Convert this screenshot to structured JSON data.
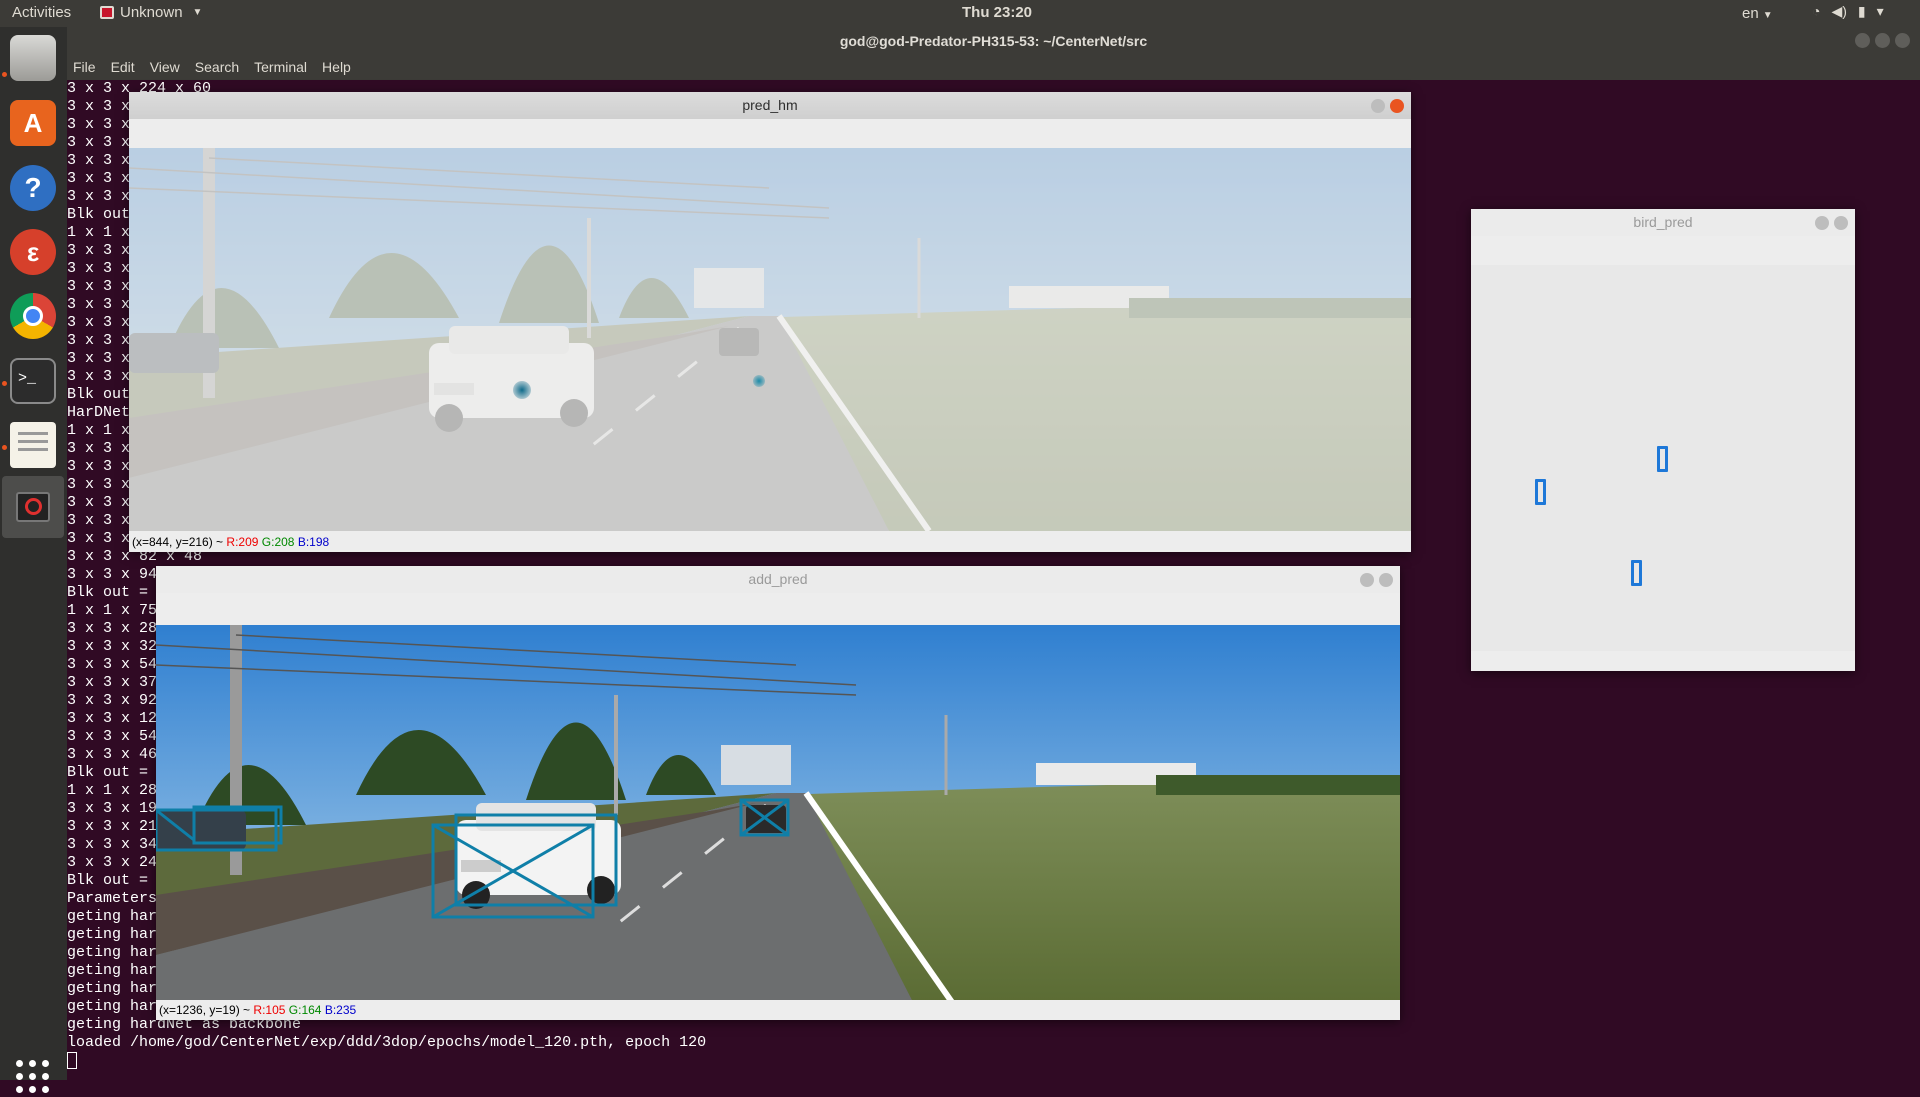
{
  "topbar": {
    "activities": "Activities",
    "app_name": "Unknown",
    "clock": "Thu 23:20",
    "lang": "en"
  },
  "dock": {
    "items": [
      "files-icon",
      "software-center-icon",
      "help-icon",
      "tool-icon",
      "chrome-icon",
      "terminal-icon",
      "text-editor-icon",
      "app-icon"
    ],
    "show_apps": "show-applications-icon"
  },
  "terminal": {
    "title": "god@god-Predator-PH315-53: ~/CenterNet/src",
    "menu": [
      "File",
      "Edit",
      "View",
      "Search",
      "Terminal",
      "Help"
    ],
    "lines": [
      "3 x 3 x 224 x 60",
      "3 x 3 x",
      "3 x 3 x",
      "3 x 3 x",
      "3 x 3 x",
      "3 x 3 x",
      "3 x 3 x",
      "Blk out",
      "1 x 1 x",
      "3 x 3 x",
      "3 x 3 x",
      "3 x 3 x",
      "3 x 3 x",
      "3 x 3 x",
      "3 x 3 x",
      "3 x 3 x",
      "3 x 3 x",
      "Blk out",
      "HarDNet",
      "1 x 1 x",
      "3 x 3 x",
      "3 x 3 x",
      "3 x 3 x",
      "3 x 3 x",
      "3 x 3 x",
      "3 x 3 x",
      "3 x 3 x 82 x 48",
      "3 x 3 x 94",
      "Blk out =",
      "1 x 1 x 75",
      "3 x 3 x 28",
      "3 x 3 x 32",
      "3 x 3 x 54",
      "3 x 3 x 37",
      "3 x 3 x 92",
      "3 x 3 x 12",
      "3 x 3 x 54",
      "3 x 3 x 46",
      "Blk out =",
      "1 x 1 x 28",
      "3 x 3 x 19",
      "3 x 3 x 21",
      "3 x 3 x 34",
      "3 x 3 x 24",
      "Blk out =",
      "Parameters",
      "geting har",
      "geting har",
      "geting har",
      "geting har",
      "geting har",
      "geting har",
      "geting hardNet as backbone",
      "loaded /home/god/CenterNet/exp/ddd/3dop/epochs/model_120.pth, epoch 120"
    ]
  },
  "windows": {
    "pred_hm": {
      "title": "pred_hm",
      "status_pos": "(x=844, y=216) ~",
      "r": "R:209",
      "g": "G:208",
      "b": "B:198"
    },
    "add_pred": {
      "title": "add_pred",
      "status_pos": "(x=1236, y=19) ~",
      "r": "R:105",
      "g": "G:164",
      "b": "B:235"
    },
    "bird_pred": {
      "title": "bird_pred",
      "boxes": 3
    }
  },
  "colors": {
    "terminal_bg": "#300a24",
    "accent": "#e95420",
    "box_color": "#1e78d8"
  }
}
